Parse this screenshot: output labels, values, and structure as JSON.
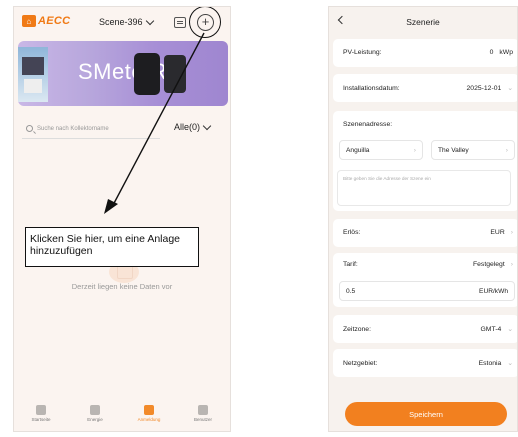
{
  "left": {
    "logo": "AECC",
    "scene_selector": "Scene-396",
    "banner_text": "SMete   RS",
    "search_placeholder": "Suche nach Kollektorname",
    "filter_label": "Alle(0)",
    "empty_text": "Derzeit liegen keine Daten vor",
    "callout": "Klicken Sie hier, um eine Anlage hinzuzufügen",
    "nav": [
      {
        "label": "Startseite",
        "icon": "home-icon"
      },
      {
        "label": "Energie",
        "icon": "energy-icon"
      },
      {
        "label": "Anmeldung",
        "icon": "plant-icon",
        "active": true
      },
      {
        "label": "Benutzer",
        "icon": "user-icon"
      }
    ]
  },
  "right": {
    "title": "Szenerie",
    "pv_label": "PV-Leistung:",
    "pv_value": "0",
    "pv_unit": "kWp",
    "install_label": "Installationsdatum:",
    "install_value": "2025-12-01",
    "address_label": "Szenenadresse:",
    "country": "Anguilla",
    "city": "The Valley",
    "address_placeholder": "Bitte geben Sie die Adresse der Szene ein",
    "revenue_label": "Erlös:",
    "revenue_value": "EUR",
    "tariff_label": "Tarif:",
    "tariff_value": "Festgelegt",
    "price_value": "0.5",
    "price_unit": "EUR/kWh",
    "timezone_label": "Zeitzone:",
    "timezone_value": "GMT-4",
    "grid_label": "Netzgebiet:",
    "grid_value": "Estonia",
    "save_label": "Speichern"
  },
  "colors": {
    "accent": "#f2801f",
    "callout_border": "#111111"
  }
}
